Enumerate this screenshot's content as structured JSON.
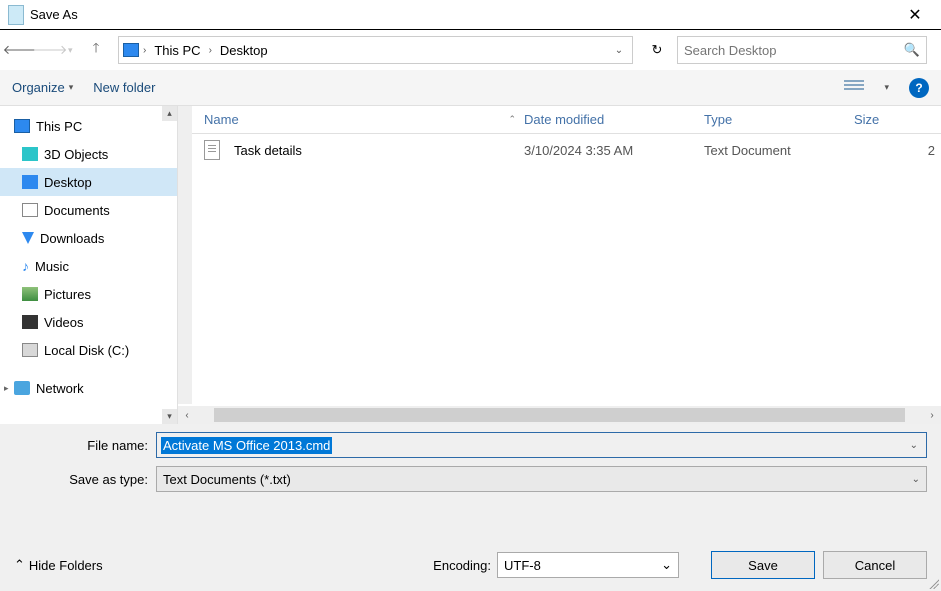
{
  "title": "Save As",
  "breadcrumb": {
    "root_icon": "pc",
    "items": [
      "This PC",
      "Desktop"
    ]
  },
  "search": {
    "placeholder": "Search Desktop"
  },
  "toolbar": {
    "organize": "Organize",
    "newfolder": "New folder"
  },
  "tree": {
    "top": "This PC",
    "items": [
      {
        "icon": "3d",
        "label": "3D Objects"
      },
      {
        "icon": "desk",
        "label": "Desktop",
        "selected": true
      },
      {
        "icon": "doc",
        "label": "Documents"
      },
      {
        "icon": "down",
        "label": "Downloads"
      },
      {
        "icon": "music",
        "label": "Music"
      },
      {
        "icon": "pic",
        "label": "Pictures"
      },
      {
        "icon": "vid",
        "label": "Videos"
      },
      {
        "icon": "disk",
        "label": "Local Disk (C:)"
      }
    ],
    "network": "Network"
  },
  "columns": {
    "name": "Name",
    "date": "Date modified",
    "type": "Type",
    "size": "Size"
  },
  "files": [
    {
      "name": "Task details",
      "date": "3/10/2024 3:35 AM",
      "type": "Text Document",
      "size": "2"
    }
  ],
  "filename": {
    "label": "File name:",
    "value": "Activate MS Office 2013.cmd"
  },
  "savetype": {
    "label": "Save as type:",
    "value": "Text Documents (*.txt)"
  },
  "hide_folders": "Hide Folders",
  "encoding": {
    "label": "Encoding:",
    "value": "UTF-8"
  },
  "buttons": {
    "save": "Save",
    "cancel": "Cancel"
  }
}
